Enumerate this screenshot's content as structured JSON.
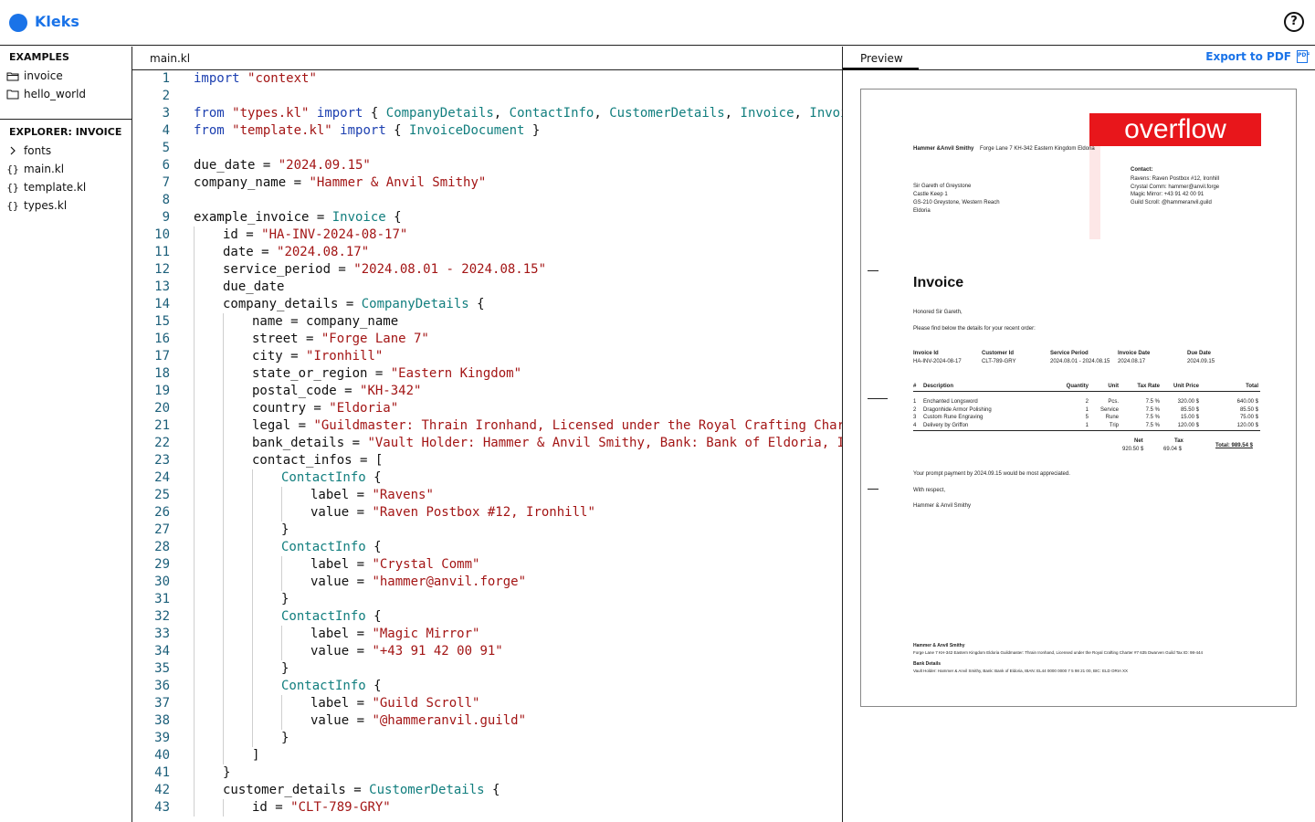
{
  "app": {
    "title": "Kleks",
    "help_icon": "help-icon",
    "accent": "#1a73e8"
  },
  "sidebar": {
    "examples_title": "EXAMPLES",
    "examples": [
      {
        "label": "invoice",
        "icon": "folder-icon"
      },
      {
        "label": "hello_world",
        "icon": "folder-icon"
      }
    ],
    "explorer_title": "EXPLORER: INVOICE",
    "files": [
      {
        "label": "fonts",
        "icon": "chevron-right-icon"
      },
      {
        "label": "main.kl",
        "icon": "braces-icon"
      },
      {
        "label": "template.kl",
        "icon": "braces-icon"
      },
      {
        "label": "types.kl",
        "icon": "braces-icon"
      }
    ]
  },
  "editor": {
    "tab": "main.kl",
    "lines": [
      {
        "n": "1",
        "indent": 0,
        "seg": [
          [
            "kw",
            "import"
          ],
          [
            "t",
            " "
          ],
          [
            "str",
            "\"context\""
          ]
        ]
      },
      {
        "n": "2",
        "indent": 0,
        "seg": []
      },
      {
        "n": "3",
        "indent": 0,
        "seg": [
          [
            "kw",
            "from"
          ],
          [
            "t",
            " "
          ],
          [
            "str",
            "\"types.kl\""
          ],
          [
            "t",
            " "
          ],
          [
            "kw",
            "import"
          ],
          [
            "t",
            " { "
          ],
          [
            "ty",
            "CompanyDetails"
          ],
          [
            "t",
            ", "
          ],
          [
            "ty",
            "ContactInfo"
          ],
          [
            "t",
            ", "
          ],
          [
            "ty",
            "CustomerDetails"
          ],
          [
            "t",
            ", "
          ],
          [
            "ty",
            "Invoice"
          ],
          [
            "t",
            ", "
          ],
          [
            "ty",
            "InvoiceIt"
          ]
        ]
      },
      {
        "n": "4",
        "indent": 0,
        "seg": [
          [
            "kw",
            "from"
          ],
          [
            "t",
            " "
          ],
          [
            "str",
            "\"template.kl\""
          ],
          [
            "t",
            " "
          ],
          [
            "kw",
            "import"
          ],
          [
            "t",
            " { "
          ],
          [
            "ty",
            "InvoiceDocument"
          ],
          [
            "t",
            " }"
          ]
        ]
      },
      {
        "n": "5",
        "indent": 0,
        "seg": []
      },
      {
        "n": "6",
        "indent": 0,
        "seg": [
          [
            "t",
            "due_date = "
          ],
          [
            "str",
            "\"2024.09.15\""
          ]
        ]
      },
      {
        "n": "7",
        "indent": 0,
        "seg": [
          [
            "t",
            "company_name = "
          ],
          [
            "str",
            "\"Hammer & Anvil Smithy\""
          ]
        ]
      },
      {
        "n": "8",
        "indent": 0,
        "seg": []
      },
      {
        "n": "9",
        "indent": 0,
        "seg": [
          [
            "t",
            "example_invoice = "
          ],
          [
            "ty",
            "Invoice"
          ],
          [
            "t",
            " {"
          ]
        ]
      },
      {
        "n": "10",
        "indent": 1,
        "seg": [
          [
            "t",
            "id = "
          ],
          [
            "str",
            "\"HA-INV-2024-08-17\""
          ]
        ]
      },
      {
        "n": "11",
        "indent": 1,
        "seg": [
          [
            "t",
            "date = "
          ],
          [
            "str",
            "\"2024.08.17\""
          ]
        ]
      },
      {
        "n": "12",
        "indent": 1,
        "seg": [
          [
            "t",
            "service_period = "
          ],
          [
            "str",
            "\"2024.08.01 - 2024.08.15\""
          ]
        ]
      },
      {
        "n": "13",
        "indent": 1,
        "seg": [
          [
            "t",
            "due_date"
          ]
        ]
      },
      {
        "n": "14",
        "indent": 1,
        "seg": [
          [
            "t",
            "company_details = "
          ],
          [
            "ty",
            "CompanyDetails"
          ],
          [
            "t",
            " {"
          ]
        ]
      },
      {
        "n": "15",
        "indent": 2,
        "seg": [
          [
            "t",
            "name = company_name"
          ]
        ]
      },
      {
        "n": "16",
        "indent": 2,
        "seg": [
          [
            "t",
            "street = "
          ],
          [
            "str",
            "\"Forge Lane 7\""
          ]
        ]
      },
      {
        "n": "17",
        "indent": 2,
        "seg": [
          [
            "t",
            "city = "
          ],
          [
            "str",
            "\"Ironhill\""
          ]
        ]
      },
      {
        "n": "18",
        "indent": 2,
        "seg": [
          [
            "t",
            "state_or_region = "
          ],
          [
            "str",
            "\"Eastern Kingdom\""
          ]
        ]
      },
      {
        "n": "19",
        "indent": 2,
        "seg": [
          [
            "t",
            "postal_code = "
          ],
          [
            "str",
            "\"KH-342\""
          ]
        ]
      },
      {
        "n": "20",
        "indent": 2,
        "seg": [
          [
            "t",
            "country = "
          ],
          [
            "str",
            "\"Eldoria\""
          ]
        ]
      },
      {
        "n": "21",
        "indent": 2,
        "seg": [
          [
            "t",
            "legal = "
          ],
          [
            "str",
            "\"Guildmaster: Thrain Ironhand, Licensed under the Royal Crafting Charter"
          ]
        ]
      },
      {
        "n": "22",
        "indent": 2,
        "seg": [
          [
            "t",
            "bank_details = "
          ],
          [
            "str",
            "\"Vault Holder: Hammer & Anvil Smithy, Bank: Bank of Eldoria, IBAN:"
          ]
        ]
      },
      {
        "n": "23",
        "indent": 2,
        "seg": [
          [
            "t",
            "contact_infos = ["
          ]
        ]
      },
      {
        "n": "24",
        "indent": 3,
        "seg": [
          [
            "ty",
            "ContactInfo"
          ],
          [
            "t",
            " {"
          ]
        ]
      },
      {
        "n": "25",
        "indent": 4,
        "seg": [
          [
            "t",
            "label = "
          ],
          [
            "str",
            "\"Ravens\""
          ]
        ]
      },
      {
        "n": "26",
        "indent": 4,
        "seg": [
          [
            "t",
            "value = "
          ],
          [
            "str",
            "\"Raven Postbox #12, Ironhill\""
          ]
        ]
      },
      {
        "n": "27",
        "indent": 3,
        "seg": [
          [
            "t",
            "}"
          ]
        ]
      },
      {
        "n": "28",
        "indent": 3,
        "seg": [
          [
            "ty",
            "ContactInfo"
          ],
          [
            "t",
            " {"
          ]
        ]
      },
      {
        "n": "29",
        "indent": 4,
        "seg": [
          [
            "t",
            "label = "
          ],
          [
            "str",
            "\"Crystal Comm\""
          ]
        ]
      },
      {
        "n": "30",
        "indent": 4,
        "seg": [
          [
            "t",
            "value = "
          ],
          [
            "str",
            "\"hammer@anvil.forge\""
          ]
        ]
      },
      {
        "n": "31",
        "indent": 3,
        "seg": [
          [
            "t",
            "}"
          ]
        ]
      },
      {
        "n": "32",
        "indent": 3,
        "seg": [
          [
            "ty",
            "ContactInfo"
          ],
          [
            "t",
            " {"
          ]
        ]
      },
      {
        "n": "33",
        "indent": 4,
        "seg": [
          [
            "t",
            "label = "
          ],
          [
            "str",
            "\"Magic Mirror\""
          ]
        ]
      },
      {
        "n": "34",
        "indent": 4,
        "seg": [
          [
            "t",
            "value = "
          ],
          [
            "str",
            "\"+43 91 42 00 91\""
          ]
        ]
      },
      {
        "n": "35",
        "indent": 3,
        "seg": [
          [
            "t",
            "}"
          ]
        ]
      },
      {
        "n": "36",
        "indent": 3,
        "seg": [
          [
            "ty",
            "ContactInfo"
          ],
          [
            "t",
            " {"
          ]
        ]
      },
      {
        "n": "37",
        "indent": 4,
        "seg": [
          [
            "t",
            "label = "
          ],
          [
            "str",
            "\"Guild Scroll\""
          ]
        ]
      },
      {
        "n": "38",
        "indent": 4,
        "seg": [
          [
            "t",
            "value = "
          ],
          [
            "str",
            "\"@hammeranvil.guild\""
          ]
        ]
      },
      {
        "n": "39",
        "indent": 3,
        "seg": [
          [
            "t",
            "}"
          ]
        ]
      },
      {
        "n": "40",
        "indent": 2,
        "seg": [
          [
            "t",
            "]"
          ]
        ]
      },
      {
        "n": "41",
        "indent": 1,
        "seg": [
          [
            "t",
            "}"
          ]
        ]
      },
      {
        "n": "42",
        "indent": 1,
        "seg": [
          [
            "t",
            "customer_details = "
          ],
          [
            "ty",
            "CustomerDetails"
          ],
          [
            "t",
            " {"
          ]
        ]
      },
      {
        "n": "43",
        "indent": 2,
        "seg": [
          [
            "t",
            "id = "
          ],
          [
            "str",
            "\"CLT-789-GRY\""
          ]
        ]
      }
    ]
  },
  "preview": {
    "tab": "Preview",
    "export_label": "Export to PDF",
    "pdf_icon": "pdf-icon",
    "doc": {
      "overflow_label": "overflow",
      "sender_line": "Hammer &Anvil Smithy",
      "sender_address": "Forge Lane 7 KH-342 Eastern Kingdom Eldoria",
      "recipient": [
        "Sir Gareth of Greystone",
        "Castle Keep 1",
        "GS-210 Greystone, Western Reach",
        "Eldoria"
      ],
      "contact_title": "Contact:",
      "contacts": [
        "Ravens: Raven Postbox #12, Ironhill",
        "Crystal Comm: hammer@anvil.forge",
        "Magic Mirror: +43 91 42 00 91",
        "Guild Scroll: @hammeranvil.guild"
      ],
      "title": "Invoice",
      "greeting": "Honored Sir Gareth,",
      "intro": "Please find below the details for your recent order:",
      "meta_headers": [
        "Invoice Id",
        "Customer Id",
        "Service Period",
        "Invoice Date",
        "Due Date"
      ],
      "meta_values": [
        "HA-INV-2024-08-17",
        "CLT-789-GRY",
        "2024.08.01 - 2024.08.15",
        "2024.08.17",
        "2024.09.15"
      ],
      "item_headers": [
        "#",
        "Description",
        "Quantity",
        "Unit",
        "Tax Rate",
        "Unit Price",
        "Total"
      ],
      "items": [
        [
          "1",
          "Enchanted Longsword",
          "2",
          "Pcs.",
          "7.5 %",
          "320.00 $",
          "640.00 $"
        ],
        [
          "2",
          "Dragonhide Armor Polishing",
          "1",
          "Service",
          "7.5 %",
          "85.50 $",
          "85.50 $"
        ],
        [
          "3",
          "Custom Rune Engraving",
          "5",
          "Rune",
          "7.5 %",
          "15.00 $",
          "75.00 $"
        ],
        [
          "4",
          "Delivery by Griffon",
          "1",
          "Trip",
          "7.5 %",
          "120.00 $",
          "120.00 $"
        ]
      ],
      "net_label": "Net",
      "net_value": "920.50 $",
      "tax_label": "Tax",
      "tax_value": "69.04 $",
      "total_label": "Total: 989.54 $",
      "closing_note": "Your prompt payment by 2024.09.15 would be most appreciated.",
      "regards": "With respect,",
      "signature": "Hammer & Anvil Smithy",
      "footer_company": "Hammer & Anvil Smithy",
      "footer_legal": "Forge Lane 7 KH-342 Eastern Kingdom Eldoria Guildmaster: Thrain Ironhand, Licensed under the Royal Crafting Charter #7 635 Dwarven Guild Tax ID: 98-444",
      "footer_bank_title": "Bank Details",
      "footer_bank": "Vault Holder: Hammer & Anvil Smithy, Bank: Bank of Eldoria, IBAN: EL44 0000 0000 7 5 98 21 00, BIC: ELD ORIA XX"
    }
  }
}
